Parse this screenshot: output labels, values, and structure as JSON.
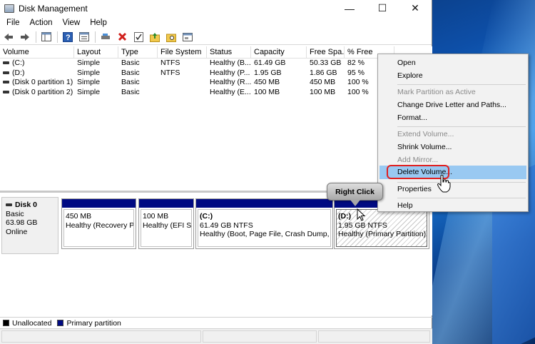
{
  "window": {
    "title": "Disk Management",
    "minimize": "—",
    "maximize": "☐",
    "close": "✕"
  },
  "menubar": [
    "File",
    "Action",
    "View",
    "Help"
  ],
  "volume_table": {
    "columns": [
      "Volume",
      "Layout",
      "Type",
      "File System",
      "Status",
      "Capacity",
      "Free Spa...",
      "% Free"
    ],
    "rows": [
      [
        "(C:)",
        "Simple",
        "Basic",
        "NTFS",
        "Healthy (B...",
        "61.49 GB",
        "50.33 GB",
        "82 %"
      ],
      [
        "(D:)",
        "Simple",
        "Basic",
        "NTFS",
        "Healthy (P...",
        "1.95 GB",
        "1.86 GB",
        "95 %"
      ],
      [
        "(Disk 0 partition 1)",
        "Simple",
        "Basic",
        "",
        "Healthy (R...",
        "450 MB",
        "450 MB",
        "100 %"
      ],
      [
        "(Disk 0 partition 2)",
        "Simple",
        "Basic",
        "",
        "Healthy (E...",
        "100 MB",
        "100 MB",
        "100 %"
      ]
    ]
  },
  "disk": {
    "name": "Disk 0",
    "type": "Basic",
    "size": "63.98 GB",
    "state": "Online"
  },
  "partitions": [
    {
      "title": "",
      "size": "450 MB",
      "status": "Healthy (Recovery Par"
    },
    {
      "title": "",
      "size": "100 MB",
      "status": "Healthy (EFI Sys"
    },
    {
      "title": "(C:)",
      "size": "61.49 GB NTFS",
      "status": "Healthy (Boot, Page File, Crash Dump, Prin"
    },
    {
      "title": "(D:)",
      "size": "1.95 GB NTFS",
      "status": "Healthy (Primary Partition)"
    }
  ],
  "legend": {
    "unallocated": "Unallocated",
    "primary": "Primary partition",
    "unallocated_color": "#000000",
    "primary_color": "#000a82"
  },
  "context_menu": {
    "open": "Open",
    "explore": "Explore",
    "mark_active": "Mark Partition as Active",
    "change_letter": "Change Drive Letter and Paths...",
    "format": "Format...",
    "extend": "Extend Volume...",
    "shrink": "Shrink Volume...",
    "add_mirror": "Add Mirror...",
    "delete": "Delete Volume...",
    "properties": "Properties",
    "help": "Help"
  },
  "callout": "Right Click",
  "colors": {
    "highlight": "#99c9f2",
    "ring": "#e02020",
    "partition_bar": "#000a82"
  }
}
